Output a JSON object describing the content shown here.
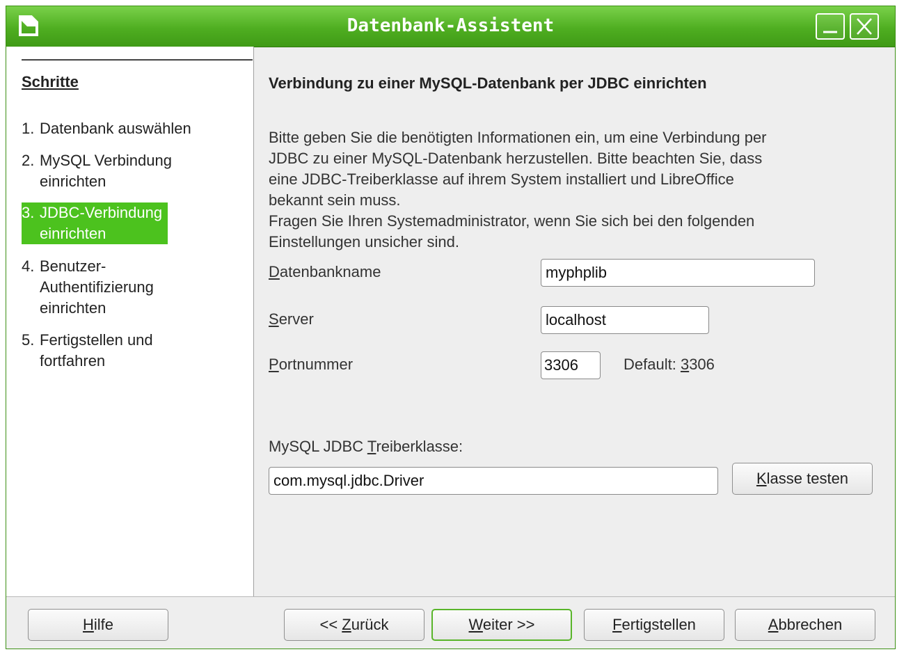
{
  "window": {
    "title": "Datenbank-Assistent"
  },
  "steps": {
    "heading": "Schritte",
    "items": [
      {
        "num": "1.",
        "label": "Datenbank auswählen",
        "lines": [
          "Datenbank auswählen"
        ]
      },
      {
        "num": "2.",
        "label": "MySQL Verbindung einrichten",
        "lines": [
          "MySQL Verbindung",
          "einrichten"
        ]
      },
      {
        "num": "3.",
        "label": "JDBC-Verbindung einrichten",
        "lines": [
          "JDBC-Verbindung",
          "einrichten"
        ],
        "active": true
      },
      {
        "num": "4.",
        "label": "Benutzer-Authentifizierung einrichten",
        "lines": [
          "Benutzer-",
          "Authentifizierung",
          "einrichten"
        ]
      },
      {
        "num": "5.",
        "label": "Fertigstellen und fortfahren",
        "lines": [
          "Fertigstellen und",
          "fortfahren"
        ]
      }
    ]
  },
  "content": {
    "heading": "Verbindung zu einer MySQL-Datenbank per JDBC einrichten",
    "info_lines": [
      "Bitte geben Sie die benötigten Informationen ein, um eine Verbindung per",
      "JDBC zu einer MySQL-Datenbank herzustellen. Bitte beachten Sie, dass",
      "eine JDBC-Treiberklasse auf ihrem System installiert und LibreOffice",
      "bekannt sein muss.",
      "Fragen Sie Ihren Systemadministrator, wenn Sie sich bei den folgenden",
      "Einstellungen unsicher sind."
    ]
  },
  "form": {
    "database_name": {
      "label_mnemonic": "D",
      "label_rest": "atenbankname",
      "value": "myphplib"
    },
    "server": {
      "label_mnemonic": "S",
      "label_rest": "erver",
      "value": "localhost"
    },
    "port": {
      "label_mnemonic": "P",
      "label_rest": "ortnummer",
      "value": "3306",
      "default_prefix": "Default: ",
      "default_mnemonic": "3",
      "default_rest": "306"
    },
    "driver": {
      "label_prefix": "MySQL JDBC ",
      "label_mnemonic": "T",
      "label_rest": "reiberklasse:",
      "value": "com.mysql.jdbc.Driver"
    }
  },
  "buttons": {
    "test_class": {
      "mnemonic": "K",
      "rest": "lasse testen"
    },
    "help": {
      "mnemonic": "H",
      "rest": "ilfe"
    },
    "back": {
      "prefix": "<< ",
      "mnemonic": "Z",
      "rest": "urück"
    },
    "next": {
      "mnemonic": "W",
      "rest": "eiter >>"
    },
    "finish": {
      "mnemonic": "F",
      "rest": "ertigstellen"
    },
    "cancel": {
      "mnemonic": "A",
      "rest": "bbrechen"
    }
  },
  "colors": {
    "titlebar": "#4fae21",
    "active_step": "#4cc21e",
    "default_button_border": "#59b52a"
  },
  "icons": {
    "app": "libreoffice-document-icon",
    "minimize": "minimize-icon",
    "close": "close-icon"
  }
}
